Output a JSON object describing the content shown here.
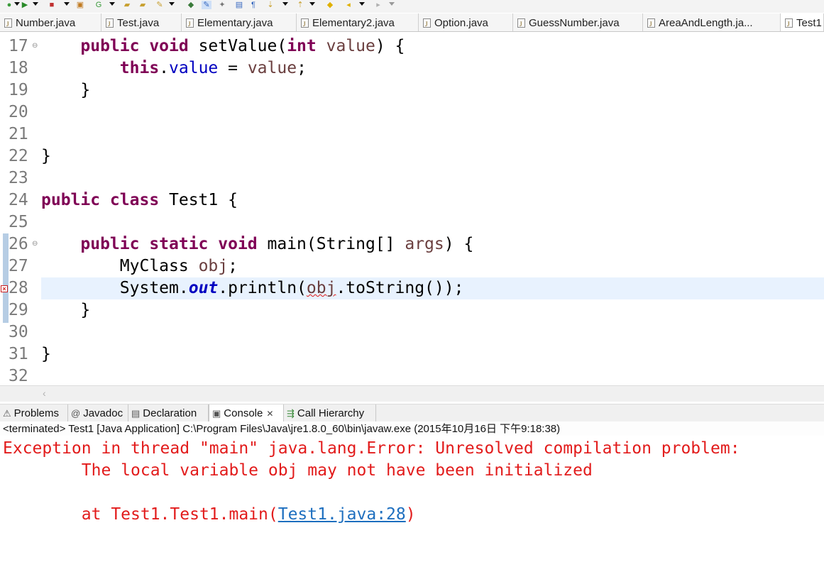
{
  "editor_tabs": [
    {
      "label": "Number.java"
    },
    {
      "label": "Test.java"
    },
    {
      "label": "Elementary.java"
    },
    {
      "label": "Elementary2.java"
    },
    {
      "label": "Option.java"
    },
    {
      "label": "GuessNumber.java"
    },
    {
      "label": "AreaAndLength.ja..."
    },
    {
      "label": "Test1"
    }
  ],
  "line_numbers": [
    "17",
    "18",
    "19",
    "20",
    "21",
    "22",
    "23",
    "24",
    "25",
    "26",
    "27",
    "28",
    "29",
    "30",
    "31",
    "32"
  ],
  "code": {
    "l17_kw": "public void",
    "l17_name": "setValue(",
    "l17_type": "int",
    "l17_param": "value",
    "l17_rest": ") {",
    "l18_kw": "this",
    "l18_dot": ".",
    "l18_field": "value",
    "l18_eq": " = ",
    "l18_param": "value",
    "l18_end": ";",
    "l19": "}",
    "l22": "}",
    "l24_kw": "public class",
    "l24_rest": " Test1 {",
    "l26_kw": "public static void",
    "l26_rest": " main(String[] ",
    "l26_param": "args",
    "l26_end": ") {",
    "l27_type": "MyClass ",
    "l27_var": "obj",
    "l27_end": ";",
    "l28_sys": "System.",
    "l28_out": "out",
    "l28_mid": ".println(",
    "l28_err": "obj",
    "l28_end": ".toString());",
    "l29": "}",
    "l31": "}"
  },
  "view_tabs": [
    {
      "label": "Problems",
      "icon": "problems-icon"
    },
    {
      "label": "Javadoc",
      "icon": "@"
    },
    {
      "label": "Declaration",
      "icon": "declaration-icon"
    },
    {
      "label": "Console",
      "icon": "console-icon",
      "active": true
    },
    {
      "label": "Call Hierarchy",
      "icon": "call-hierarchy-icon"
    }
  ],
  "console": {
    "header": "<terminated> Test1 [Java Application] C:\\Program Files\\Java\\jre1.8.0_60\\bin\\javaw.exe (2015年10月16日 下午9:18:38)",
    "line1": "Exception in thread \"main\" java.lang.Error: Unresolved compilation problem:",
    "line2": "        The local variable obj may not have been initialized",
    "line3_prefix": "        at Test1.Test1.main(",
    "line3_link": "Test1.java:28",
    "line3_suffix": ")"
  },
  "colors": {
    "keyword": "#7f0055",
    "field": "#0000c0",
    "error_text": "#e21b1b",
    "link": "#1e6fbf",
    "current_line": "#e8f2fe"
  }
}
